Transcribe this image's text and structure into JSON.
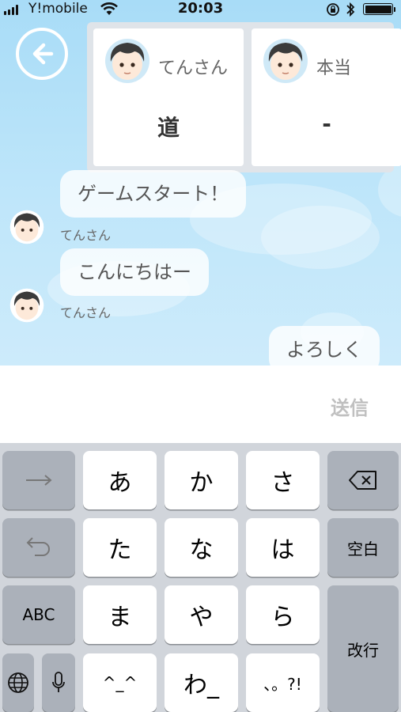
{
  "status_bar": {
    "carrier": "Y!mobile",
    "time": "20:03"
  },
  "players": [
    {
      "name": "てんさん",
      "word": "道"
    },
    {
      "name": "本当",
      "word": "-"
    }
  ],
  "messages": [
    {
      "text": "ゲームスタート！",
      "sender": "てんさん",
      "side": "left"
    },
    {
      "text": "こんにちはー",
      "sender": "てんさん",
      "side": "left"
    },
    {
      "text": "よろしく",
      "sender": "",
      "side": "right"
    }
  ],
  "input": {
    "value": "",
    "placeholder": "",
    "send_label": "送信"
  },
  "keyboard": {
    "kana_rows": [
      [
        "あ",
        "か",
        "さ"
      ],
      [
        "た",
        "な",
        "は"
      ],
      [
        "ま",
        "や",
        "ら"
      ],
      [
        "^_^",
        "わ_",
        "、。?!"
      ]
    ],
    "space_label": "空白",
    "abc_label": "ABC",
    "return_label": "改行"
  },
  "colors": {
    "sky": "#a8dcf7",
    "send_disabled": "#c0c0c0",
    "keyboard_bg": "#d1d5db",
    "dark_key": "#abb1ba"
  }
}
